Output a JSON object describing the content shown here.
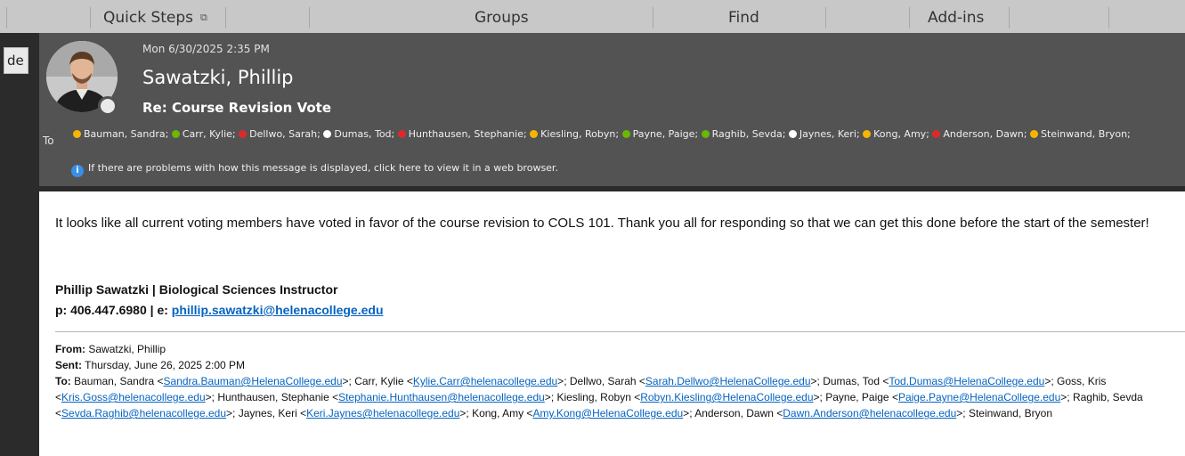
{
  "ribbon": {
    "groups": [
      {
        "label": "Quick Steps",
        "launcher": "⧉"
      },
      {
        "label": "Groups"
      },
      {
        "label": "Find"
      },
      {
        "label": "Add-ins"
      }
    ]
  },
  "left_strip": {
    "button_label": "de"
  },
  "message": {
    "date": "Mon 6/30/2025 2:35 PM",
    "sender": "Sawatzki, Phillip",
    "subject": "Re: Course Revision Vote",
    "to_label": "To",
    "recipients": [
      {
        "name": "Bauman, Sandra",
        "status": "away"
      },
      {
        "name": "Carr, Kylie",
        "status": "available"
      },
      {
        "name": "Dellwo, Sarah",
        "status": "busy"
      },
      {
        "name": "Dumas, Tod",
        "status": "offline"
      },
      {
        "name": "Hunthausen, Stephanie",
        "status": "busy"
      },
      {
        "name": "Kiesling, Robyn",
        "status": "away"
      },
      {
        "name": "Payne, Paige",
        "status": "available"
      },
      {
        "name": "Raghib, Sevda",
        "status": "available"
      },
      {
        "name": "Jaynes, Keri",
        "status": "offline"
      },
      {
        "name": "Kong, Amy",
        "status": "away"
      },
      {
        "name": "Anderson, Dawn",
        "status": "busy"
      },
      {
        "name": "Steinwand, Bryon",
        "status": "away"
      }
    ],
    "info_bar": "If there are problems with how this message is displayed, click here to view it in a web browser.",
    "body_text": "It looks like all current voting members have voted in favor of the course revision to COLS 101. Thank you all for responding so that we can get this done before the start of the semester!",
    "signature": {
      "line1": "Phillip Sawatzki | Biological Sciences Instructor",
      "phone_prefix": "p: 406.447.6980 | e: ",
      "email": "phillip.sawatzki@helenacollege.edu"
    },
    "original": {
      "from_label": "From:",
      "from": "Sawatzki, Phillip",
      "sent_label": "Sent:",
      "sent": "Thursday, June 26, 2025 2:00 PM",
      "to_label": "To:",
      "to": [
        {
          "name": "Bauman, Sandra",
          "email": "Sandra.Bauman@HelenaCollege.edu"
        },
        {
          "name": "Carr, Kylie",
          "email": "Kylie.Carr@helenacollege.edu"
        },
        {
          "name": "Dellwo, Sarah",
          "email": "Sarah.Dellwo@HelenaCollege.edu"
        },
        {
          "name": "Dumas, Tod",
          "email": "Tod.Dumas@HelenaCollege.edu"
        },
        {
          "name": "Goss, Kris",
          "email": "Kris.Goss@helenacollege.edu"
        },
        {
          "name": "Hunthausen, Stephanie",
          "email": "Stephanie.Hunthausen@helenacollege.edu"
        },
        {
          "name": "Kiesling, Robyn",
          "email": "Robyn.Kiesling@HelenaCollege.edu"
        },
        {
          "name": "Payne, Paige",
          "email": "Paige.Payne@HelenaCollege.edu"
        },
        {
          "name": "Raghib, Sevda",
          "email": "Sevda.Raghib@helenacollege.edu"
        },
        {
          "name": "Jaynes, Keri",
          "email": "Keri.Jaynes@helenacollege.edu"
        },
        {
          "name": "Kong, Amy",
          "email": "Amy.Kong@HelenaCollege.edu"
        },
        {
          "name": "Anderson, Dawn",
          "email": "Dawn.Anderson@helenacollege.edu"
        },
        {
          "name": "Steinwand, Bryon",
          "email": ""
        }
      ]
    }
  },
  "colors": {
    "header_bg": "#535353",
    "link": "#0563c1",
    "presence_away": "#f7b500",
    "presence_available": "#6bb700",
    "presence_busy": "#d92b2b",
    "presence_offline": "#ffffff"
  },
  "icons": [
    "dialog-launcher-icon",
    "presence-icon",
    "info-icon",
    "avatar-photo"
  ]
}
